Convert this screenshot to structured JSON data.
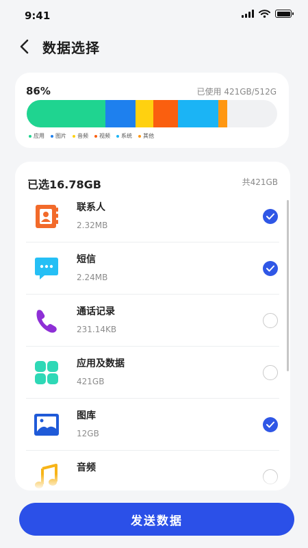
{
  "status_bar": {
    "time": "9:41"
  },
  "header": {
    "title": "数据选择"
  },
  "storage": {
    "percent_label": "86%",
    "used_label": "已使用 421GB/512G",
    "fill_fraction": 0.86,
    "segments": [
      {
        "name": "应用",
        "fraction": 0.315,
        "color": "#1fd490"
      },
      {
        "name": "图片",
        "fraction": 0.12,
        "color": "#1e80ee"
      },
      {
        "name": "音频",
        "fraction": 0.07,
        "color": "#ffd110"
      },
      {
        "name": "视频",
        "fraction": 0.1,
        "color": "#fa5f0f"
      },
      {
        "name": "系统",
        "fraction": 0.16,
        "color": "#1bb4f5"
      },
      {
        "name": "其他",
        "fraction": 0.035,
        "color": "#ff9712"
      }
    ]
  },
  "list": {
    "selected_label": "已选16.78GB",
    "total_label": "共421GB",
    "items": [
      {
        "name": "联系人",
        "size": "2.32MB",
        "icon": "contacts-book-icon",
        "checked": true
      },
      {
        "name": "短信",
        "size": "2.24MB",
        "icon": "message-bubble-icon",
        "checked": true
      },
      {
        "name": "通话记录",
        "size": "231.14KB",
        "icon": "phone-icon",
        "checked": false
      },
      {
        "name": "应用及数据",
        "size": "421GB",
        "icon": "apps-grid-icon",
        "checked": false
      },
      {
        "name": "图库",
        "size": "12GB",
        "icon": "gallery-image-icon",
        "checked": true
      },
      {
        "name": "音频",
        "size": "",
        "icon": "music-note-icon",
        "checked": false
      }
    ]
  },
  "action": {
    "send_label": "发送数据"
  },
  "colors": {
    "accent": "#2b50e8",
    "check": "#2f57e6"
  }
}
